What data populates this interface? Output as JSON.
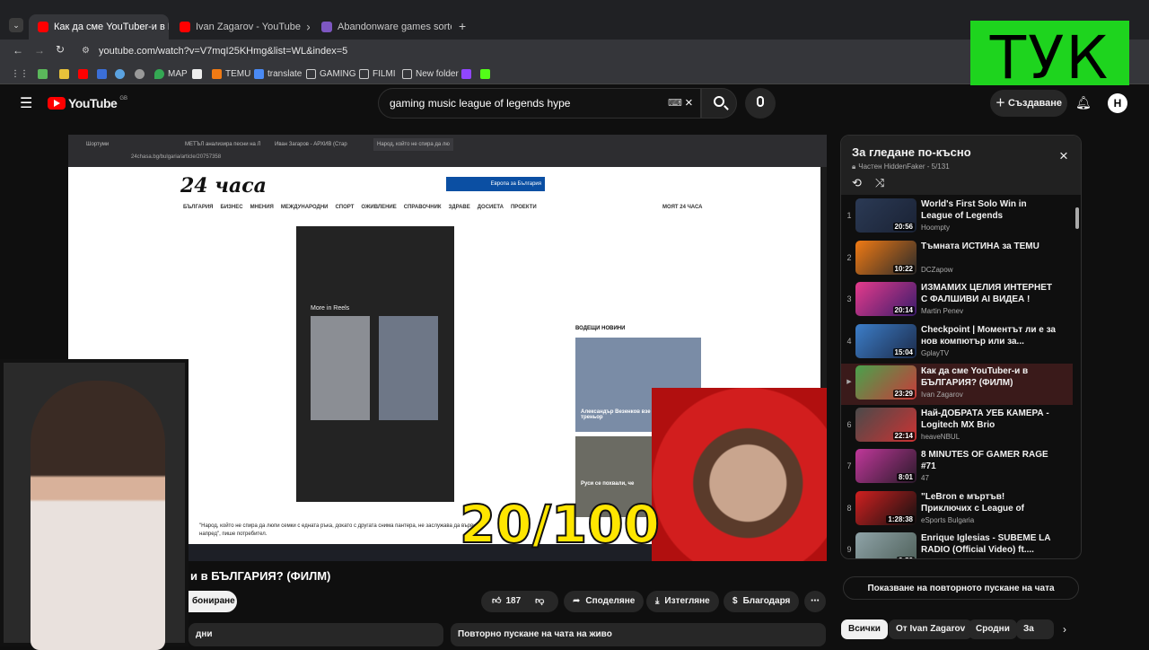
{
  "browser": {
    "tabs": [
      {
        "label": "Как да сме YouTuber-и в Б",
        "color": "#ff0000",
        "active": true
      },
      {
        "label": "Ivan Zagarov - YouTube",
        "color": "#ff0000",
        "active": false
      },
      {
        "label": "Abandonware games sorted by",
        "color": "#7e57c2",
        "active": false
      }
    ],
    "url": "youtube.com/watch?v=V7mqI25KHmg&list=WL&index=5",
    "bookmarks": [
      "MAP",
      "TEMU",
      "translate",
      "GAMING",
      "FILMI",
      "New folder"
    ]
  },
  "overlay": {
    "tyk_text": "ТУК"
  },
  "youtube": {
    "logo_text": "YouTube",
    "region": "GB",
    "search_value": "gaming music league of legends hype",
    "create_label": "Създаване",
    "avatar_letter": "H"
  },
  "video": {
    "inner_tabs": [
      "Шортуми",
      "МЕТЪЛ анализира песни на Л",
      "Иван Загаров - АРХИВ (Стар",
      "Народ, който не спира да лю"
    ],
    "inner_url": "24chasa.bg/bulgaria/article/20757358",
    "site_logo": "24 часа",
    "site_nav": [
      "БЪЛГАРИЯ",
      "БИЗНЕС",
      "МНЕНИЯ",
      "МЕЖДУНАРОДНИ",
      "СПОРТ",
      "ОЖИВЛЕНИЕ",
      "СПРАВОЧНИК",
      "ЗДРАВЕ",
      "ДОСИЕТА",
      "ПРОЕКТИ"
    ],
    "site_nav_right": "МОЯТ 24 ЧАСА",
    "reel_label": "More in Reels",
    "news_header": "ВОДЕЩИ НОВИНИ",
    "news1": "Александър Везенков взе диплома за треньор",
    "news2": "Руси се похвали, че",
    "caption": "\"Народ, който не спира да люпи семки с едната ръка, докато с другата снима пантера, не заслужава да върви напред\", пише потребител.",
    "score_overlay": "20/100"
  },
  "below": {
    "title_fragment": "и в БЪЛГАРИЯ? (ФИЛМ)",
    "subscribe_fragment": "бониране",
    "likes": "187",
    "share": "Споделяне",
    "download": "Изтегляне",
    "thanks": "Благодаря",
    "card_left": "дни",
    "card_right": "Повторно пускане на чата на живо"
  },
  "playlist": {
    "title": "За гледане по-късно",
    "meta": "Частен HiddenFaker - 5/131",
    "items": [
      {
        "n": "1",
        "title": "World's First Solo Win in League of Legends",
        "channel": "Hoompty",
        "dur": "20:56",
        "c1": "#2b3a55",
        "c2": "#1a2234"
      },
      {
        "n": "2",
        "title": "Тъмната ИСТИНА за TEMU",
        "channel": "DCZapow",
        "dur": "10:22",
        "c1": "#f07a14",
        "c2": "#2a2a2a"
      },
      {
        "n": "3",
        "title": "ИЗМАМИХ ЦЕЛИЯ ИНТЕРНЕТ С ФАЛШИВИ AI ВИДЕА !",
        "channel": "Martin Penev",
        "dur": "20:14",
        "c1": "#e53b8c",
        "c2": "#3a1c6b"
      },
      {
        "n": "4",
        "title": "Checkpoint | Моментът ли е за нов компютър или за...",
        "channel": "GplayTV",
        "dur": "15:04",
        "c1": "#3c7ec9",
        "c2": "#1c2b4a"
      },
      {
        "n": "",
        "title": "Как да сме YouTuber-и в БЪЛГАРИЯ? (ФИЛМ)",
        "channel": "Ivan Zagarov",
        "dur": "23:29",
        "c1": "#49a24c",
        "c2": "#c93a3a"
      },
      {
        "n": "6",
        "title": "Най-ДОБРАТА УЕБ КАМЕРА - Logitech MX Brio",
        "channel": "heaveNBUL",
        "dur": "22:14",
        "c1": "#4a4a4a",
        "c2": "#cc3333"
      },
      {
        "n": "7",
        "title": "8 MINUTES OF GAMER RAGE #71",
        "channel": "47",
        "dur": "8:01",
        "c1": "#c0389a",
        "c2": "#2a1a2a"
      },
      {
        "n": "8",
        "title": "\"LeBron е мъртъв! Приключих с League of Legends...",
        "channel": "eSports Bulgaria",
        "dur": "1:28:38",
        "c1": "#d12020",
        "c2": "#111111"
      },
      {
        "n": "9",
        "title": "Enrique Iglesias - SUBEME LA RADIO (Official Video) ft....",
        "channel": "Enrique Iglesias",
        "dur": "3:53",
        "c1": "#8fa3a8",
        "c2": "#4d5f58"
      }
    ],
    "replay_label": "Показване на повторното пускане на чата",
    "chips": [
      "Всички",
      "От Ivan Zagarov",
      "Сродни",
      "За вас"
    ]
  }
}
